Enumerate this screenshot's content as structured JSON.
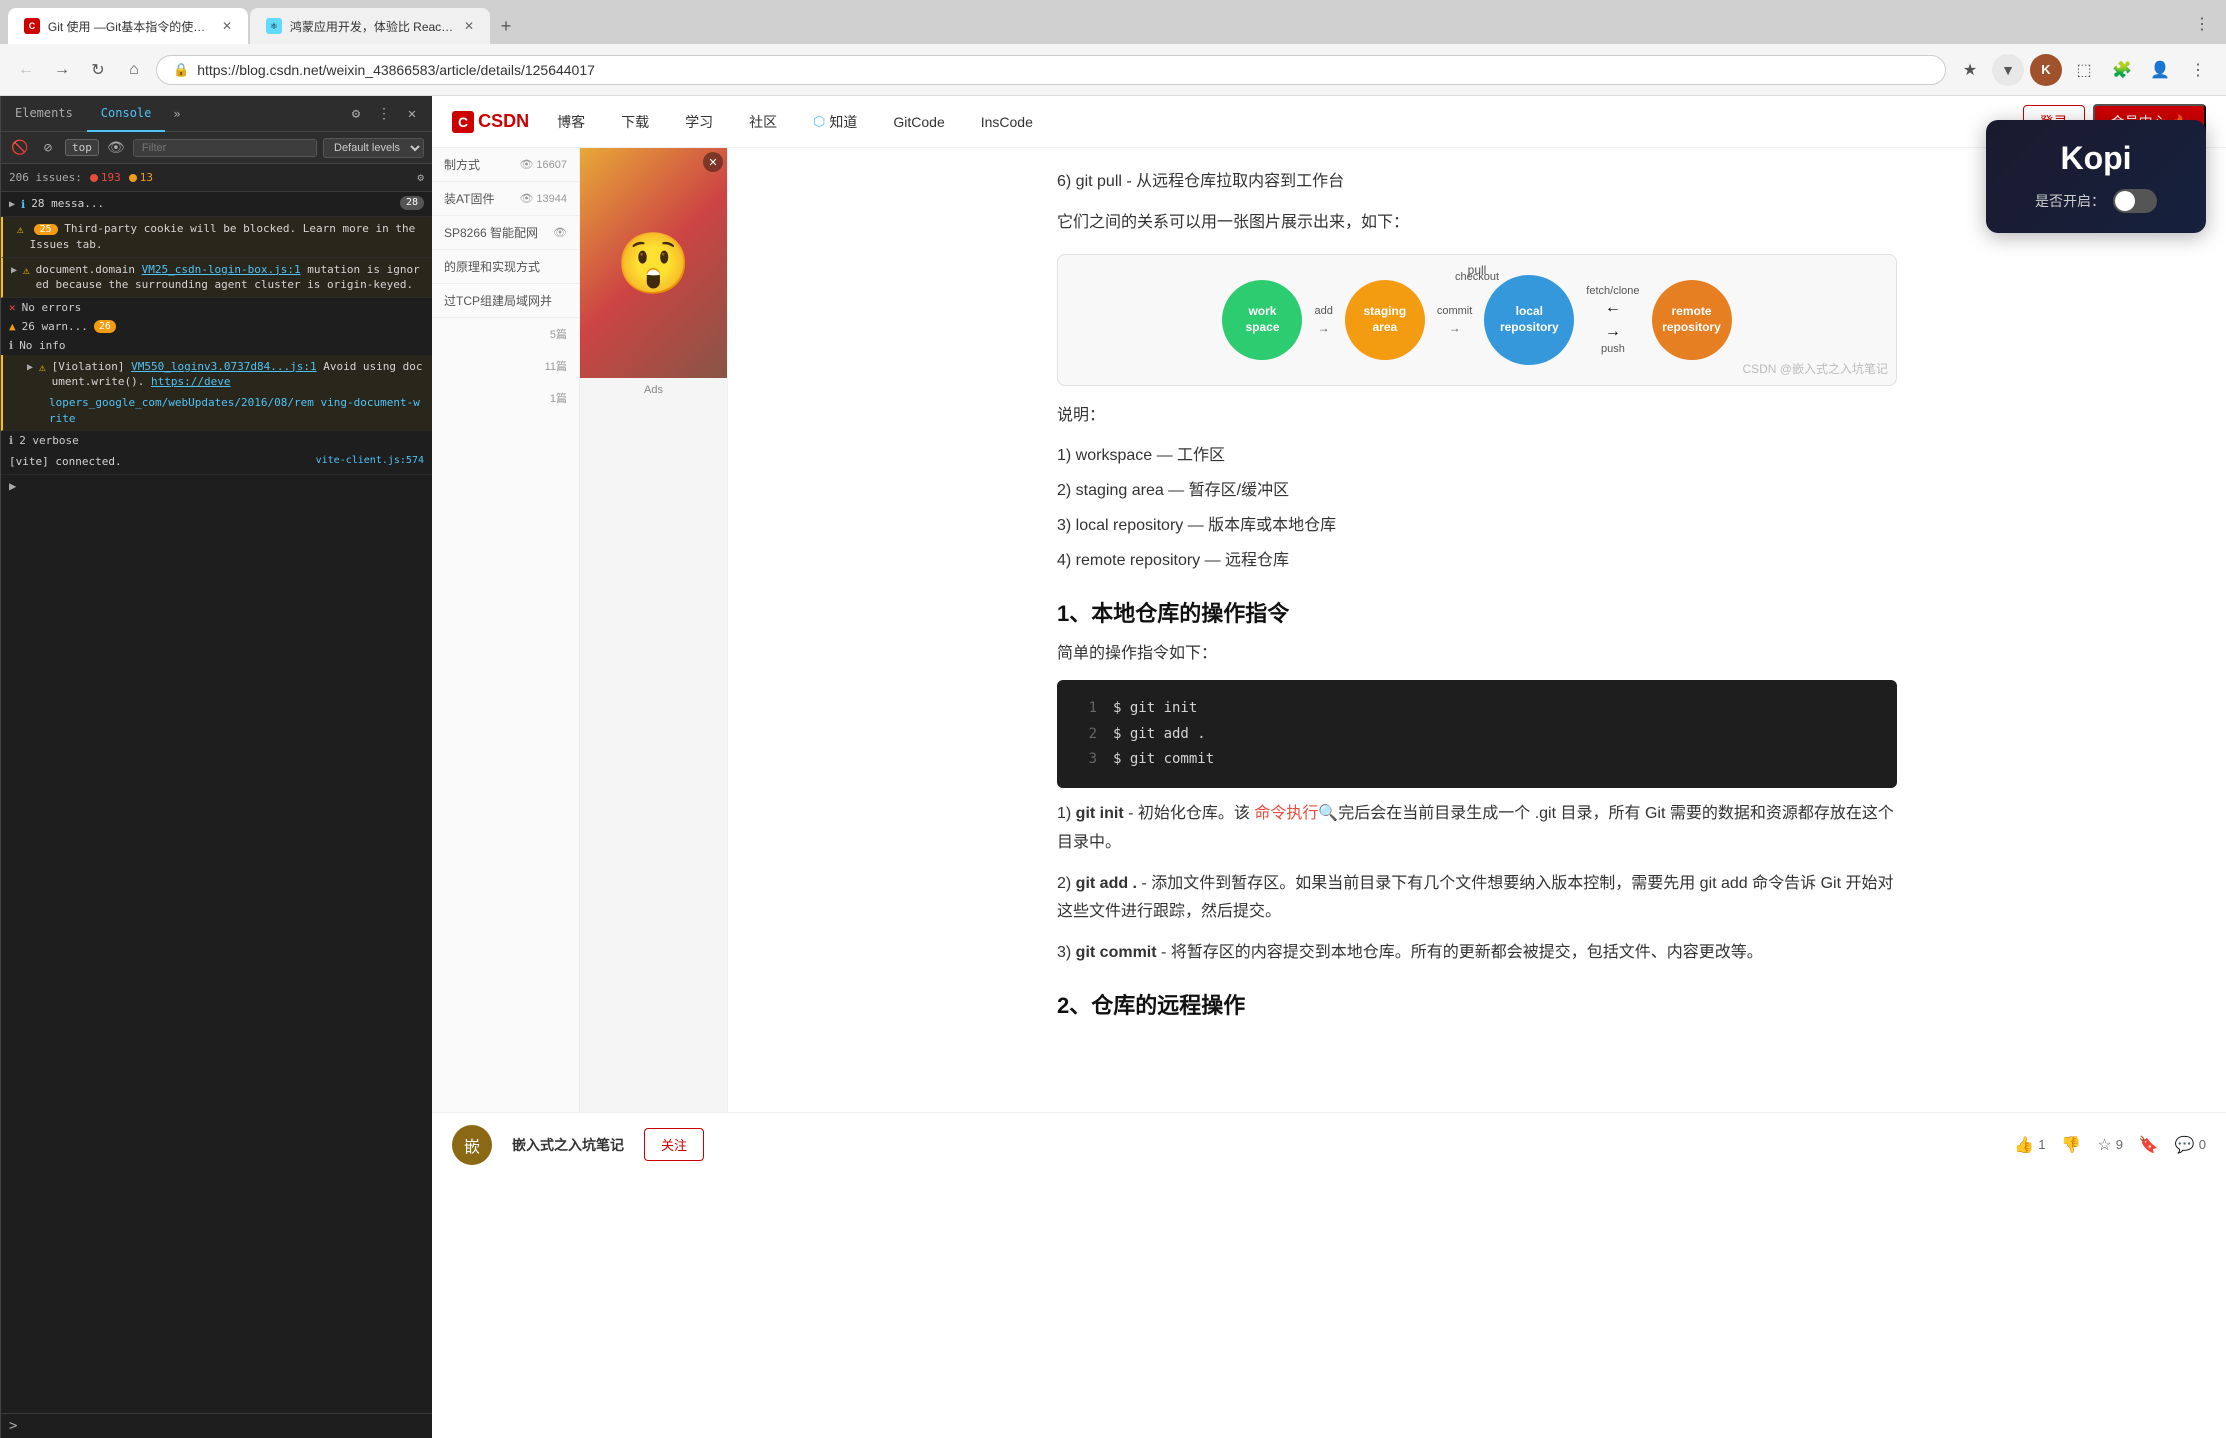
{
  "browser": {
    "tabs": [
      {
        "id": "tab1",
        "label": "Git 使用 —Git基本指令的使用...",
        "favicon": "C",
        "active": true
      },
      {
        "id": "tab2",
        "label": "鸿蒙应用开发，体验比 React ...",
        "favicon": "R",
        "active": false
      }
    ],
    "address": "https://blog.csdn.net/weixin_43866583/article/details/125644017"
  },
  "devtools": {
    "tabs": [
      "Elements",
      "Console",
      "»"
    ],
    "active_tab": "Console",
    "warning_count": "26",
    "info_count": "193",
    "issues_count": "206",
    "issues_red": "193",
    "issues_yellow": "13",
    "top_label": "top",
    "filter_placeholder": "Filter",
    "level_label": "Default levels",
    "messages": [
      {
        "type": "info",
        "icon": "▶",
        "count": "28",
        "text": "28 messa...",
        "expandable": true
      },
      {
        "type": "warning",
        "icon": "⚠",
        "count": "25",
        "text": "Third-party cookie will be blocked. Learn more in the Issues tab.",
        "expandable": false
      },
      {
        "type": "warning",
        "icon": "⚠",
        "text": "document.domain VM25_csdn-login-box.js:1 mutation is ignored because the surrounding agent cluster is origin-keyed.",
        "link": "VM25_csdn-login-box.js:1",
        "expandable": true
      },
      {
        "type": "error",
        "icon": "✕",
        "text": "No errors",
        "expandable": false
      },
      {
        "type": "warning",
        "icon": "⚠",
        "count": "26",
        "text": "26 warn...",
        "expandable": true
      },
      {
        "type": "info",
        "icon": "ℹ",
        "text": "No info",
        "expandable": false
      },
      {
        "type": "warning",
        "icon": "⚠",
        "text": "[Violation] VM550_loginv3.0737d84...js:1 Avoid using document.write().",
        "link_text": "https://developers.google.com/web/updates/2016/08/removing-document-write",
        "link_short": "lopers_google_com/webUpdates/2016/08/rem",
        "expandable": true
      },
      {
        "type": "info",
        "icon": "ℹ",
        "text": "2 verbose",
        "expandable": false
      },
      {
        "type": "log",
        "text": "[vite] connected.",
        "source": "vite-client.js:574"
      }
    ],
    "prompt_symbol": ">"
  },
  "csdn": {
    "logo": "CSDN",
    "nav_items": [
      "博客",
      "下载",
      "学习",
      "社区",
      "知道",
      "GitCode",
      "InsCode"
    ],
    "login_btn": "登录",
    "member_btn": "会员中心"
  },
  "article": {
    "git_pull_label": "6)  git pull - 从远程仓库拉取内容到工作台",
    "relation_text": "它们之间的关系可以用一张图片展示出来，如下：",
    "diagram": {
      "pull_arrow": "pull",
      "nodes": [
        {
          "label": "workspace",
          "color": "#2ecc71"
        },
        {
          "label": "staging area",
          "color": "#f39c12"
        },
        {
          "label": "local repository",
          "color": "#3498db"
        },
        {
          "label": "remote repository",
          "color": "#e67e22"
        }
      ],
      "arrows": [
        "add",
        "commit",
        "fetch/clone",
        "checkout",
        "push"
      ],
      "watermark": "CSDN @嵌入式之入坑笔记"
    },
    "description_title": "说明：",
    "description_items": [
      "1)  workspace — 工作区",
      "2)  staging area — 暂存区/缓冲区",
      "3)  local repository — 版本库或本地仓库",
      "4)  remote repository — 远程仓库"
    ],
    "section1_title": "1、本地仓库的操作指令",
    "section1_intro": "简单的操作指令如下：",
    "code_lines": [
      {
        "num": "1",
        "code": "$ git init"
      },
      {
        "num": "2",
        "code": "$ git add ."
      },
      {
        "num": "3",
        "code": "$ git commit"
      }
    ],
    "git_init_desc": "1)  git init - 初始化仓库。该 命令执行🔍完后会在当前目录生成一个 .git 目录，所有 Git 需要的数据和资源都存放在这个目录中。",
    "git_add_desc": "2)  git add . - 添加文件到暂存区。如果当前目录下有几个文件想要纳入版本控制，需要先用 git add 命令告诉 Git 开始对这些文件进行跟踪，然后提交。",
    "git_commit_desc": "3)  git commit - 将暂存区的内容提交到本地仓库。所有的更新都会被提交，包括文件、内容更改等。",
    "section2_title": "2、仓库的远程操作"
  },
  "sidebar": {
    "items": [
      {
        "text": "制方式",
        "views": "16607"
      },
      {
        "text": "装AT固件",
        "views": "13944"
      },
      {
        "text": "SP8266 智能配网"
      },
      {
        "text": "的原理和实现方式"
      },
      {
        "text": "过TCP组建局域网并"
      }
    ],
    "article_counts": [
      "5篇",
      "11篇",
      "1篇"
    ]
  },
  "kopi_widget": {
    "title": "Kopi",
    "toggle_label": "是否开启：",
    "toggle_on": false
  },
  "bottom_bar": {
    "author_name": "嵌入式之入坑笔记",
    "follow_btn": "关注",
    "like_count": "1",
    "dislike_icon": "👎",
    "star_count": "9",
    "bookmark_icon": "🔖",
    "comment_count": "0"
  },
  "ads": {
    "label": "Ads"
  }
}
